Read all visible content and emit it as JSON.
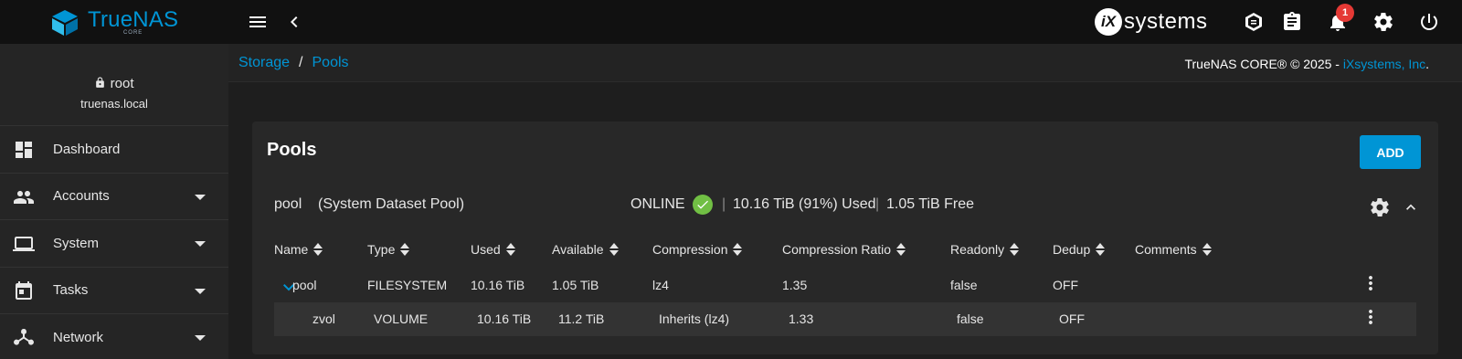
{
  "app": {
    "name": "TrueNAS",
    "edition": "CORE",
    "vendor_logo_text": "systems",
    "vendor_logo_mark": "iX",
    "notification_count": "1"
  },
  "user": {
    "name": "root",
    "host": "truenas.local"
  },
  "sidebar": {
    "items": [
      {
        "label": "Dashboard",
        "icon": "dashboard-icon",
        "expandable": false
      },
      {
        "label": "Accounts",
        "icon": "people-icon",
        "expandable": true
      },
      {
        "label": "System",
        "icon": "laptop-icon",
        "expandable": true
      },
      {
        "label": "Tasks",
        "icon": "calendar-icon",
        "expandable": true
      },
      {
        "label": "Network",
        "icon": "network-icon",
        "expandable": true
      }
    ]
  },
  "breadcrumb": {
    "root": "Storage",
    "separator": "/",
    "current": "Pools"
  },
  "footer": {
    "copyright": "TrueNAS CORE® © 2025 - ",
    "company": "iXsystems, Inc",
    "period": "."
  },
  "pools_card": {
    "title": "Pools",
    "add_label": "ADD",
    "pool": {
      "name": "pool",
      "dataset_note": "(System Dataset Pool)",
      "status": "ONLINE",
      "separator": "|",
      "used": "10.16 TiB (91%) Used",
      "free": "1.05 TiB Free"
    },
    "columns": [
      "Name",
      "Type",
      "Used",
      "Available",
      "Compression",
      "Compression Ratio",
      "Readonly",
      "Dedup",
      "Comments"
    ],
    "rows": [
      {
        "name": "pool",
        "type": "FILESYSTEM",
        "used": "10.16 TiB",
        "available": "1.05 TiB",
        "compression": "lz4",
        "ratio": "1.35",
        "readonly": "false",
        "dedup": "OFF",
        "comments": ""
      },
      {
        "name": "zvol",
        "type": "VOLUME",
        "used": "10.16 TiB",
        "available": "11.2 TiB",
        "compression": "Inherits (lz4)",
        "ratio": "1.33",
        "readonly": "false",
        "dedup": "OFF",
        "comments": ""
      }
    ]
  },
  "colors": {
    "accent": "#0095d5",
    "online": "#71bf44",
    "badge": "#e53935"
  }
}
